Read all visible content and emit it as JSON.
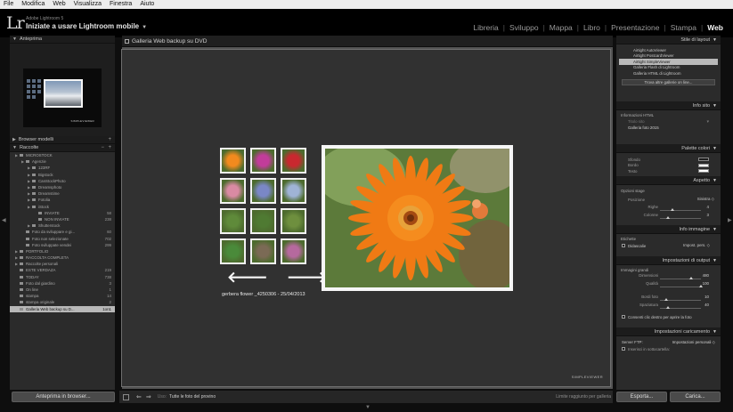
{
  "os_menu": [
    "File",
    "Modifica",
    "Web",
    "Visualizza",
    "Finestra",
    "Aiuto"
  ],
  "header": {
    "logo": "Lr",
    "app_name": "Adobe Lightroom 5",
    "catalog": "Iniziate a usare Lightroom mobile",
    "catalog_caret": "▼",
    "modules": [
      "Libreria",
      "Sviluppo",
      "Mappa",
      "Libro",
      "Presentazione",
      "Stampa",
      "Web"
    ],
    "active_module": "Web"
  },
  "left": {
    "preview_title": "Anteprima",
    "preview_brand": "SIMPLEVIEWER",
    "templates_title": "Browser modelli",
    "collections_title": "Raccolte",
    "collections": [
      {
        "label": "MICROSTOCK",
        "count": "",
        "level": 1
      },
      {
        "label": "Agenzie",
        "count": "",
        "level": 2
      },
      {
        "label": "123RF",
        "count": "",
        "level": 3
      },
      {
        "label": "Bigstock",
        "count": "",
        "level": 3
      },
      {
        "label": "CanStockPhoto",
        "count": "",
        "level": 3
      },
      {
        "label": "Dreamsphoto",
        "count": "",
        "level": 3
      },
      {
        "label": "Dreamstime",
        "count": "",
        "level": 3
      },
      {
        "label": "Fotolia",
        "count": "",
        "level": 3
      },
      {
        "label": "iStock",
        "count": "",
        "level": 3
      },
      {
        "label": "INVIATE",
        "count": "58",
        "level": 4
      },
      {
        "label": "NON INVIATE",
        "count": "238",
        "level": 4
      },
      {
        "label": "Shutterstock",
        "count": "",
        "level": 3
      },
      {
        "label": "Foto da sviluppare e gi...",
        "count": "60",
        "level": 2
      },
      {
        "label": "Foto non selezionate",
        "count": "702",
        "level": 2
      },
      {
        "label": "Foto sviluppate vendei",
        "count": "299",
        "level": 2
      },
      {
        "label": "PORTFOLIO",
        "count": "",
        "level": 1
      },
      {
        "label": "RACCOLTA COMPLETA",
        "count": "",
        "level": 1
      },
      {
        "label": "Raccolte personali",
        "count": "",
        "level": 1
      },
      {
        "label": "ESTE VERDAZA",
        "count": "219",
        "level": 1
      },
      {
        "label": "TODAY",
        "count": "738",
        "level": 1
      },
      {
        "label": "Foto dal giardino",
        "count": "3",
        "level": 1
      },
      {
        "label": "On line",
        "count": "1",
        "level": 1
      },
      {
        "label": "stampa",
        "count": "14",
        "level": 1
      },
      {
        "label": "stampa originale",
        "count": "2",
        "level": 1
      },
      {
        "label": "Galleria Web backup su D...",
        "count": "1on1",
        "level": 1,
        "selected": true
      }
    ],
    "preview_button": "Anteprima in browser..."
  },
  "center": {
    "title": "Galleria Web backup su DVD",
    "caption": "gerbera flower _4250306 - 25/04/2013",
    "brand": "SIMPLEVIEWER",
    "thumb_colors": [
      "#f28a1e",
      "#c23c9a",
      "#c9282f",
      "#d98aa3",
      "#7a87c6",
      "#9fb3d6",
      "#5f8a3a",
      "#4f7a32",
      "#6e8f3e",
      "#4a8a3a",
      "#7b6a55",
      "#b6699e"
    ]
  },
  "toolbar": {
    "use_label": "Uso:",
    "use_value": "Tutte le foto del provino",
    "status": "Limite raggiunto per galleria"
  },
  "right": {
    "layout_title": "Stile di layout",
    "layouts": [
      "Airtight AutoViewer",
      "Airtight PostcardViewer",
      "Airtight SimpleViewer",
      "Galleria Flash di Lightroom",
      "Galleria HTML di Lightroom"
    ],
    "selected_layout": "Airtight SimpleViewer",
    "find_more": "Trova altre gallerie on line...",
    "site_title": "Info sito",
    "site_field_label": "Informazioni HTML",
    "site_field_placeholder": "Titolo sito",
    "site_field_value": "Galleria foto 2015",
    "palette_title": "Palette colori",
    "palette": [
      {
        "label": "Sfondo",
        "color": "#1e1e1e"
      },
      {
        "label": "Bordo",
        "color": "#ffffff"
      },
      {
        "label": "Testo",
        "color": "#ffffff"
      }
    ],
    "appearance_title": "Aspetto",
    "appearance_sub": "Opzioni stage",
    "position_label": "Posizione",
    "position_value": "Sinistra ◇",
    "rows_label": "Righe",
    "rows_value": "4",
    "rows_fill": 0.3,
    "cols_label": "Colonne",
    "cols_value": "3",
    "cols_fill": 0.2,
    "image_info_title": "Info immagine",
    "captions_label": "Etichette",
    "caption_check": "Didascalie",
    "caption_value": "Impost. pers. ◇",
    "output_title": "Impostazioni di output",
    "large_images": "Immagini grandi",
    "dimensions_label": "Dimensioni",
    "dimensions_value": "480",
    "dimensions_fill": 0.75,
    "quality_label": "Qualità",
    "quality_value": "100",
    "quality_fill": 1.0,
    "border_label": "Bordi foto",
    "border_value": "10",
    "border_fill": 0.15,
    "padding_label": "Spaziatura",
    "padding_value": "40",
    "padding_fill": 0.2,
    "rightclick_label": "Consenti clic destro per aprire la foto",
    "upload_title": "Impostazioni caricamento",
    "ftp_label": "Server FTP:",
    "ftp_value": "Impostazioni personali ◇",
    "subfolder_label": "Inserisci in sottocartella:",
    "export_button": "Esporta...",
    "upload_button": "Carica..."
  }
}
